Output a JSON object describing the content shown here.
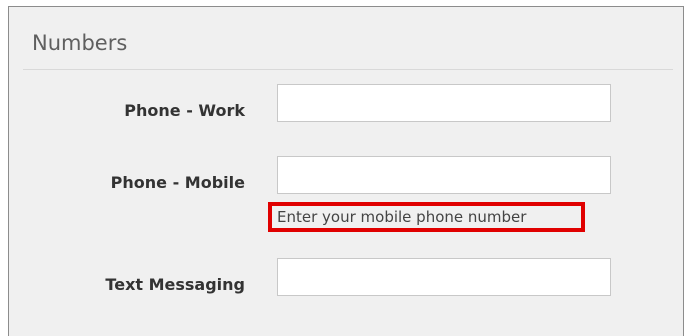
{
  "section": {
    "title": "Numbers"
  },
  "fields": [
    {
      "label": "Phone - Work",
      "value": "",
      "placeholder": ""
    },
    {
      "label": "Phone - Mobile",
      "value": "",
      "placeholder": ""
    },
    {
      "label": "Text Messaging",
      "value": "",
      "placeholder": ""
    }
  ],
  "mobile_hint": "Enter your mobile phone number",
  "colors": {
    "panel_bg": "#f0f0f0",
    "highlight": "#e00000"
  }
}
